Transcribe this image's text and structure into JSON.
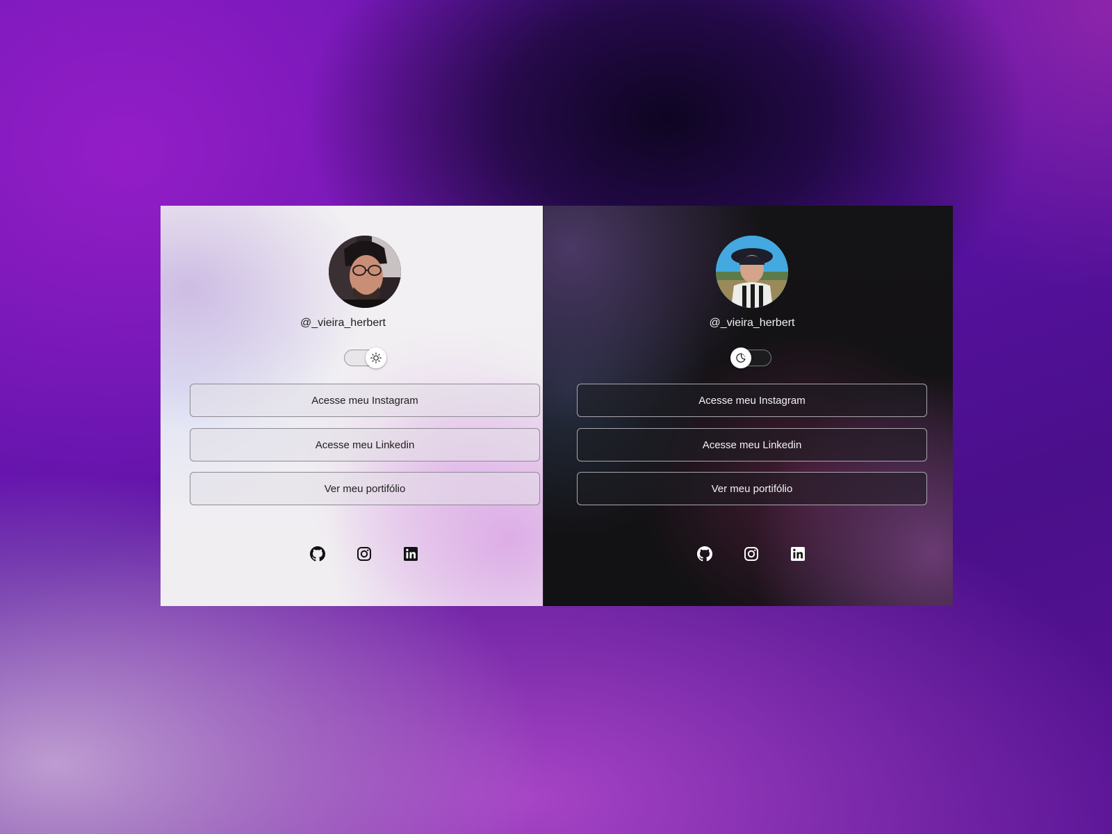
{
  "colors": {
    "light_panel_bg": "#f0eef1",
    "dark_panel_bg": "#121113",
    "light_text": "#1e1e1e",
    "dark_text": "#f2f2f2",
    "page_bg_accent": "#6a17b5"
  },
  "light_card": {
    "theme": "light",
    "username": "@_vieira_herbert",
    "theme_toggle": {
      "state": "light",
      "icon": "sun-icon"
    },
    "buttons": [
      {
        "label": "Acesse meu Instagram"
      },
      {
        "label": "Acesse meu Linkedin"
      },
      {
        "label": "Ver meu portifólio"
      }
    ],
    "social_icons": [
      "github-icon",
      "instagram-icon",
      "linkedin-icon"
    ]
  },
  "dark_card": {
    "theme": "dark",
    "username": "@_vieira_herbert",
    "theme_toggle": {
      "state": "dark",
      "icon": "moon-icon"
    },
    "buttons": [
      {
        "label": "Acesse meu Instagram"
      },
      {
        "label": "Acesse meu Linkedin"
      },
      {
        "label": "Ver meu portifólio"
      }
    ],
    "social_icons": [
      "github-icon",
      "instagram-icon",
      "linkedin-icon"
    ]
  }
}
